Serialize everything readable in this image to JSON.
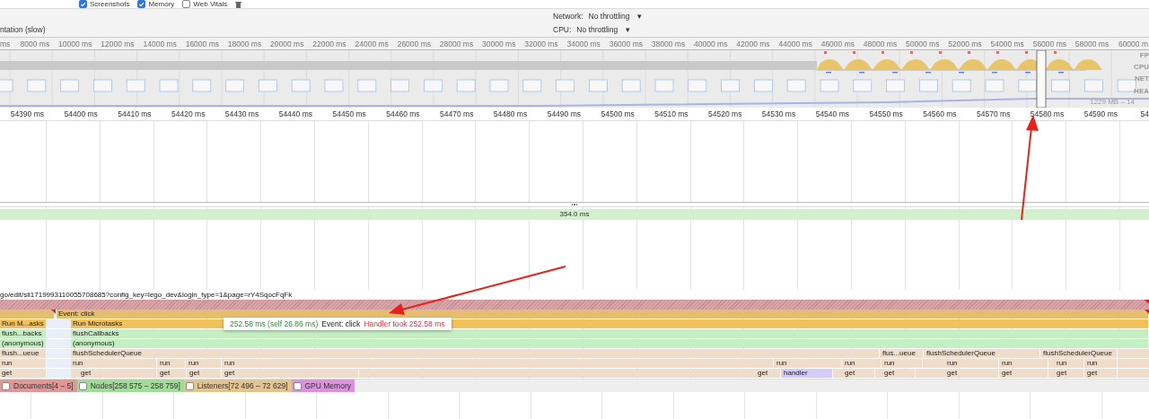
{
  "toolbar": {
    "checkboxes": [
      {
        "label": "Screenshots",
        "checked": true
      },
      {
        "label": "Memory",
        "checked": true
      },
      {
        "label": "Web Vitals",
        "checked": false
      }
    ]
  },
  "settings": {
    "paint_instrumentation_label": "ntation (slow)",
    "throttles": [
      {
        "label": "Network:",
        "value": "No throttling",
        "caret": "▾"
      },
      {
        "label": "CPU:",
        "value": "No throttling",
        "caret": "▾"
      }
    ]
  },
  "overview": {
    "ticks": [
      "ms",
      "8000 ms",
      "10000 ms",
      "12000 ms",
      "14000 ms",
      "16000 ms",
      "18000 ms",
      "20000 ms",
      "22000 ms",
      "24000 ms",
      "26000 ms",
      "28000 ms",
      "30000 ms",
      "32000 ms",
      "34000 ms",
      "36000 ms",
      "38000 ms",
      "40000 ms",
      "42000 ms",
      "44000 ms",
      "46000 ms",
      "48000 ms",
      "50000 ms",
      "52000 ms",
      "54000 ms",
      "56000 ms",
      "58000 ms",
      "60000 m"
    ],
    "lanes": [
      "FP",
      "CPU",
      "NET",
      "HEA"
    ],
    "heap_range": "1229 MB – 14"
  },
  "ruler": {
    "ticks": [
      "54390 ms",
      "54400 ms",
      "54410 ms",
      "54420 ms",
      "54430 ms",
      "54440 ms",
      "54450 ms",
      "54460 ms",
      "54470 ms",
      "54480 ms",
      "54490 ms",
      "54500 ms",
      "54510 ms",
      "54520 ms",
      "54530 ms",
      "54540 ms",
      "54550 ms",
      "54560 ms",
      "54570 ms",
      "54580 ms",
      "54590 ms",
      "54"
    ]
  },
  "interactions": [
    {
      "label": "354.0 ms"
    }
  ],
  "main_thread": {
    "url": "go/edit/sli1719993110055708685?config_key=lego_dev&login_type=1&page=rY4SqocFqFk",
    "rows": [
      {
        "blocks": [
          {
            "label": "Event: click",
            "kind": "event"
          }
        ]
      },
      {
        "blocks": [
          {
            "label": "Run M...asks",
            "kind": "task"
          },
          {
            "label": "Run Microtasks",
            "kind": "task"
          }
        ]
      },
      {
        "blocks": [
          {
            "label": "flush...backs",
            "kind": "callback"
          },
          {
            "label": "flushCallbacks",
            "kind": "callback"
          }
        ]
      },
      {
        "blocks": [
          {
            "label": "(anonymous)",
            "kind": "callback"
          },
          {
            "label": "(anonymous)",
            "kind": "callback"
          }
        ]
      },
      {
        "blocks": [
          {
            "label": "flush...ueue",
            "kind": "function"
          },
          {
            "label": "flushSchedulerQueue",
            "kind": "function"
          },
          {
            "label": "flus...ueue",
            "kind": "function"
          },
          {
            "label": "flushSchedulerQueue",
            "kind": "function"
          },
          {
            "label": "flushSchedulerQueue",
            "kind": "function"
          }
        ]
      },
      {
        "blocks": [
          {
            "label": "run",
            "kind": "function"
          },
          {
            "label": "run",
            "kind": "function"
          },
          {
            "label": "run",
            "kind": "function"
          },
          {
            "label": "run",
            "kind": "function"
          },
          {
            "label": "run",
            "kind": "function"
          },
          {
            "label": "run",
            "kind": "function"
          },
          {
            "label": "run",
            "kind": "function"
          },
          {
            "label": "run",
            "kind": "function"
          },
          {
            "label": "run",
            "kind": "function"
          },
          {
            "label": "run",
            "kind": "function"
          },
          {
            "label": "run",
            "kind": "function"
          },
          {
            "label": "run",
            "kind": "function"
          }
        ]
      },
      {
        "blocks": [
          {
            "label": "get",
            "kind": "function"
          },
          {
            "label": "get",
            "kind": "function"
          },
          {
            "label": "get",
            "kind": "function"
          },
          {
            "label": "get",
            "kind": "function"
          },
          {
            "label": "get",
            "kind": "function"
          },
          {
            "label": "get",
            "kind": "function"
          },
          {
            "label": "handler",
            "kind": "handler"
          },
          {
            "label": "get",
            "kind": "function"
          },
          {
            "label": "get",
            "kind": "function"
          },
          {
            "label": "get",
            "kind": "function"
          },
          {
            "label": "get",
            "kind": "function"
          },
          {
            "label": "get",
            "kind": "function"
          },
          {
            "label": "get",
            "kind": "function"
          }
        ]
      }
    ]
  },
  "tooltip": {
    "duration": "252.58 ms (self 26.86 ms)",
    "event": "Event: click",
    "warning": "Handler took 252.58 ms"
  },
  "counters": [
    {
      "label": "Documents[4 – 5]",
      "checked": false,
      "color": "#e49595"
    },
    {
      "label": "Nodes[258 575 – 258 759]",
      "checked": false,
      "color": "#9fdc98"
    },
    {
      "label": "Listeners[72 496 – 72 629]",
      "checked": false,
      "color": "#e4c48e"
    },
    {
      "label": "GPU Memory",
      "checked": false,
      "color": "#e08fe0"
    }
  ]
}
